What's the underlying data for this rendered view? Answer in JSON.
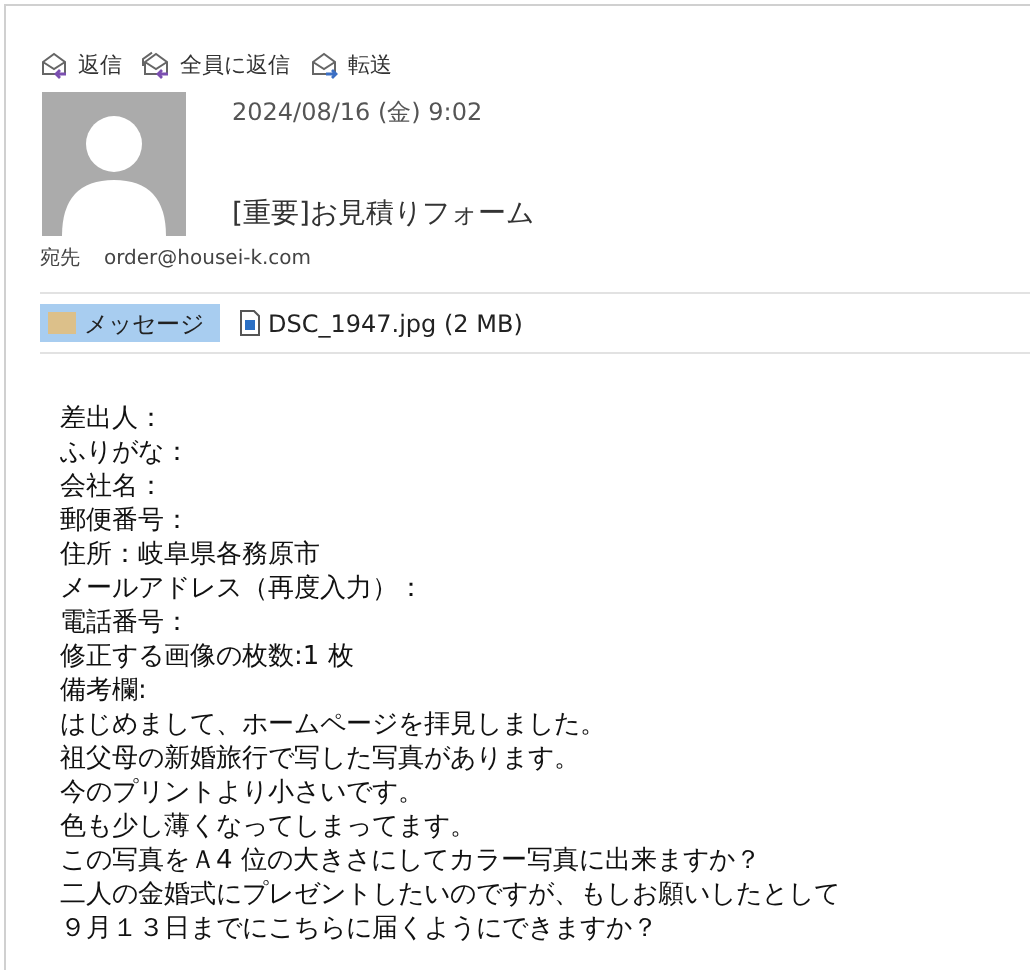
{
  "toolbar": [
    {
      "kind": "reply",
      "label": "返信"
    },
    {
      "kind": "reply_all",
      "label": "全員に返信"
    },
    {
      "kind": "forward",
      "label": "転送"
    }
  ],
  "header": {
    "date": "2024/08/16 (金) 9:02",
    "subject": "[重要]お見積りフォーム",
    "to_label": "宛先",
    "to": "order@housei-k.com"
  },
  "attachments": [
    {
      "kind": "message",
      "label": "メッセージ",
      "selected": true
    },
    {
      "kind": "file",
      "label": "DSC_1947.jpg (2 MB)",
      "selected": false
    }
  ],
  "body": [
    "差出人：",
    "ふりがな：",
    "会社名：",
    "郵便番号：",
    "住所：岐阜県各務原市",
    "メールアドレス（再度入力）：",
    "電話番号：",
    "修正する画像の枚数:1 枚",
    "備考欄:",
    "はじめまして、ホームページを拝見しました。",
    "祖父母の新婚旅行で写した写真があります。",
    "今のプリントより小さいです。",
    "色も少し薄くなってしまってます。",
    "この写真をＡ4 位の大きさにしてカラー写真に出来ますか？",
    "二人の金婚式にプレゼントしたいのですが、もしお願いしたとして",
    "９月１３日までにこちらに届くようにできますか？"
  ]
}
